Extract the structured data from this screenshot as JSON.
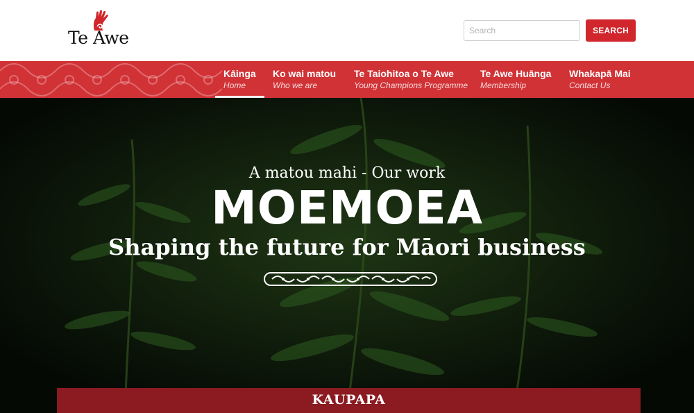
{
  "header": {
    "logo_text": "Te Awe",
    "logo_color": "#d0262c",
    "search": {
      "placeholder": "Search",
      "value": ""
    },
    "search_button_label": "SEARCH"
  },
  "nav": {
    "background": "#d13236",
    "items": [
      {
        "label": "Kāinga",
        "sublabel": "Home",
        "active": true
      },
      {
        "label": "Ko wai matou",
        "sublabel": "Who we are",
        "active": false
      },
      {
        "label": "Te Taiohitoa o Te Awe",
        "sublabel": "Young Champions Programme",
        "active": false
      },
      {
        "label": "Te Awe Huānga",
        "sublabel": "Membership",
        "active": false
      },
      {
        "label": "Whakapā Mai",
        "sublabel": "Contact Us",
        "active": false
      }
    ]
  },
  "hero": {
    "eyebrow": "A matou mahi - Our work",
    "title": "MOEMOEA",
    "subtitle": "Shaping the future for Māori business",
    "background_icon": "fern-photo",
    "ornament_icon": "maori-pattern-band"
  },
  "section": {
    "label": "KAUPAPA",
    "background": "#8b1b20"
  }
}
